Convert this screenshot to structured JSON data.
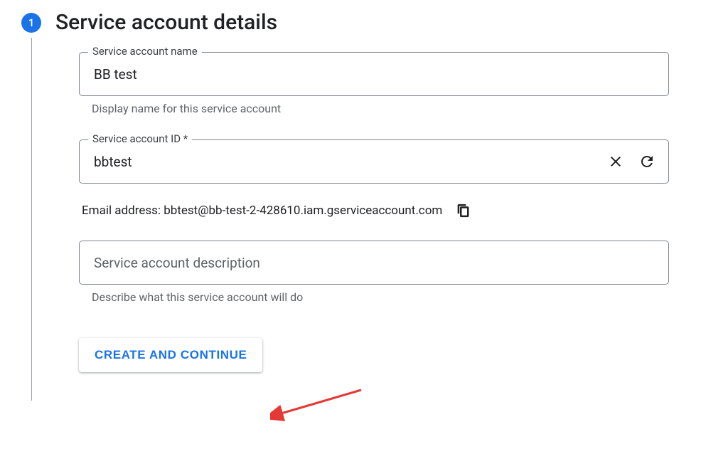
{
  "step": {
    "number": "1",
    "title": "Service account details"
  },
  "fields": {
    "name": {
      "label": "Service account name",
      "value": "BB test",
      "helper": "Display name for this service account"
    },
    "id": {
      "label": "Service account ID *",
      "value": "bbtest"
    },
    "email": {
      "label": "Email address: ",
      "value": "bbtest@bb-test-2-428610.iam.gserviceaccount.com"
    },
    "description": {
      "placeholder": "Service account description",
      "helper": "Describe what this service account will do"
    }
  },
  "actions": {
    "create": "CREATE AND CONTINUE"
  }
}
